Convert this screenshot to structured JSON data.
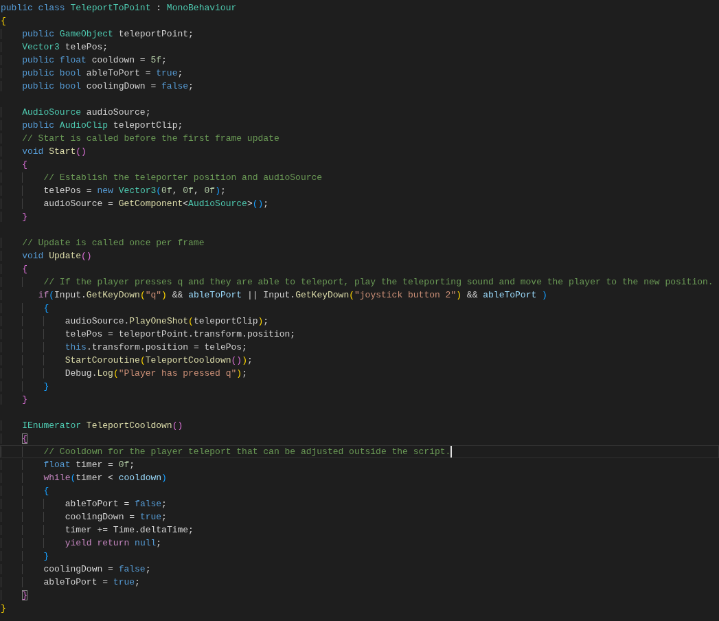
{
  "editor": {
    "lines": [
      {
        "current": false,
        "tokens": [
          {
            "text": "public class ",
            "kind": "keyword"
          },
          {
            "text": "TeleportToPoint",
            "kind": "type"
          },
          {
            "text": " : ",
            "kind": "plain"
          },
          {
            "text": "MonoBehaviour",
            "kind": "type"
          }
        ]
      },
      {
        "current": false,
        "tokens": [
          {
            "text": "{",
            "kind": "bracket0"
          }
        ]
      },
      {
        "current": false,
        "tokens": [
          {
            "text": "    public ",
            "kind": "keyword"
          },
          {
            "text": "GameObject",
            "kind": "type"
          },
          {
            "text": " teleportPoint;",
            "kind": "plain"
          }
        ]
      },
      {
        "current": false,
        "tokens": [
          {
            "text": "    Vector3",
            "kind": "type"
          },
          {
            "text": " telePos;",
            "kind": "plain"
          }
        ]
      },
      {
        "current": false,
        "tokens": [
          {
            "text": "    public float ",
            "kind": "keyword"
          },
          {
            "text": "cooldown = ",
            "kind": "plain"
          },
          {
            "text": "5f",
            "kind": "number"
          },
          {
            "text": ";",
            "kind": "plain"
          }
        ]
      },
      {
        "current": false,
        "tokens": [
          {
            "text": "    public bool ",
            "kind": "keyword"
          },
          {
            "text": "ableToPort = ",
            "kind": "plain"
          },
          {
            "text": "true",
            "kind": "keyword"
          },
          {
            "text": ";",
            "kind": "plain"
          }
        ]
      },
      {
        "current": false,
        "tokens": [
          {
            "text": "    public bool ",
            "kind": "keyword"
          },
          {
            "text": "coolingDown = ",
            "kind": "plain"
          },
          {
            "text": "false",
            "kind": "keyword"
          },
          {
            "text": ";",
            "kind": "plain"
          }
        ]
      },
      {
        "current": false
      },
      {
        "current": false,
        "tokens": [
          {
            "text": "    AudioSource",
            "kind": "type"
          },
          {
            "text": " audioSource;",
            "kind": "plain"
          }
        ]
      },
      {
        "current": false,
        "tokens": [
          {
            "text": "    public ",
            "kind": "keyword"
          },
          {
            "text": "AudioClip",
            "kind": "type"
          },
          {
            "text": " teleportClip;",
            "kind": "plain"
          }
        ]
      },
      {
        "current": false,
        "tokens": [
          {
            "text": "    // Start is called before the first frame update",
            "kind": "comment"
          }
        ]
      },
      {
        "current": false,
        "tokens": [
          {
            "text": "    void ",
            "kind": "keyword"
          },
          {
            "text": "Start",
            "kind": "function"
          },
          {
            "text": "()",
            "kind": "bracket1"
          }
        ]
      },
      {
        "current": false,
        "tokens": [
          {
            "text": "    {",
            "kind": "bracket1"
          }
        ]
      },
      {
        "current": false,
        "tokens": [
          {
            "text": "        // Establish the teleporter position and audioSource",
            "kind": "comment"
          }
        ]
      },
      {
        "current": false,
        "tokens": [
          {
            "text": "        telePos = ",
            "kind": "plain"
          },
          {
            "text": "new ",
            "kind": "keyword"
          },
          {
            "text": "Vector3",
            "kind": "type"
          },
          {
            "text": "(",
            "kind": "bracket2"
          },
          {
            "text": "0f",
            "kind": "number"
          },
          {
            "text": ", ",
            "kind": "plain"
          },
          {
            "text": "0f",
            "kind": "number"
          },
          {
            "text": ", ",
            "kind": "plain"
          },
          {
            "text": "0f",
            "kind": "number"
          },
          {
            "text": ")",
            "kind": "bracket2"
          },
          {
            "text": ";",
            "kind": "plain"
          }
        ]
      },
      {
        "current": false,
        "tokens": [
          {
            "text": "        audioSource = ",
            "kind": "plain"
          },
          {
            "text": "GetComponent",
            "kind": "function"
          },
          {
            "text": "<",
            "kind": "plain"
          },
          {
            "text": "AudioSource",
            "kind": "type"
          },
          {
            "text": ">",
            "kind": "plain"
          },
          {
            "text": "()",
            "kind": "bracket2"
          },
          {
            "text": ";",
            "kind": "plain"
          }
        ]
      },
      {
        "current": false,
        "tokens": [
          {
            "text": "    }",
            "kind": "bracket1"
          }
        ]
      },
      {
        "current": false
      },
      {
        "current": false,
        "tokens": [
          {
            "text": "    // Update is called once per frame",
            "kind": "comment"
          }
        ]
      },
      {
        "current": false,
        "tokens": [
          {
            "text": "    void ",
            "kind": "keyword"
          },
          {
            "text": "Update",
            "kind": "function"
          },
          {
            "text": "()",
            "kind": "bracket1"
          }
        ]
      },
      {
        "current": false,
        "tokens": [
          {
            "text": "    {",
            "kind": "bracket1"
          }
        ]
      },
      {
        "current": false,
        "tokens": [
          {
            "text": "        // If the player presses q and they are able to teleport, play the teleporting sound and move the player to the new position.",
            "kind": "comment"
          }
        ]
      },
      {
        "current": false,
        "tokens": [
          {
            "text": "       if",
            "kind": "control"
          },
          {
            "text": "(",
            "kind": "bracket2"
          },
          {
            "text": "Input.",
            "kind": "plain"
          },
          {
            "text": "GetKeyDown",
            "kind": "function"
          },
          {
            "text": "(",
            "kind": "bracket0"
          },
          {
            "text": "\"q\"",
            "kind": "string"
          },
          {
            "text": ")",
            "kind": "bracket0"
          },
          {
            "text": " && ",
            "kind": "plain"
          },
          {
            "text": "ableToPort",
            "kind": "variable"
          },
          {
            "text": " || ",
            "kind": "plain"
          },
          {
            "text": "Input.",
            "kind": "plain"
          },
          {
            "text": "GetKeyDown",
            "kind": "function"
          },
          {
            "text": "(",
            "kind": "bracket0"
          },
          {
            "text": "\"joystick button 2\"",
            "kind": "string"
          },
          {
            "text": ")",
            "kind": "bracket0"
          },
          {
            "text": " && ",
            "kind": "plain"
          },
          {
            "text": "ableToPort",
            "kind": "variable"
          },
          {
            "text": " )",
            "kind": "bracket2"
          }
        ]
      },
      {
        "current": false,
        "tokens": [
          {
            "text": "        {",
            "kind": "bracket2"
          }
        ]
      },
      {
        "current": false,
        "tokens": [
          {
            "text": "            audioSource.",
            "kind": "plain"
          },
          {
            "text": "PlayOneShot",
            "kind": "function"
          },
          {
            "text": "(",
            "kind": "bracket0"
          },
          {
            "text": "teleportClip",
            "kind": "plain"
          },
          {
            "text": ")",
            "kind": "bracket0"
          },
          {
            "text": ";",
            "kind": "plain"
          }
        ]
      },
      {
        "current": false,
        "tokens": [
          {
            "text": "            telePos = teleportPoint.transform.position;",
            "kind": "plain"
          }
        ]
      },
      {
        "current": false,
        "tokens": [
          {
            "text": "            this",
            "kind": "keyword"
          },
          {
            "text": ".transform.position = telePos;",
            "kind": "plain"
          }
        ]
      },
      {
        "current": false,
        "tokens": [
          {
            "text": "            StartCoroutine",
            "kind": "function"
          },
          {
            "text": "(",
            "kind": "bracket0"
          },
          {
            "text": "TeleportCooldown",
            "kind": "function"
          },
          {
            "text": "()",
            "kind": "bracket1"
          },
          {
            "text": ")",
            "kind": "bracket0"
          },
          {
            "text": ";",
            "kind": "plain"
          }
        ]
      },
      {
        "current": false,
        "tokens": [
          {
            "text": "            Debug.",
            "kind": "plain"
          },
          {
            "text": "Log",
            "kind": "function"
          },
          {
            "text": "(",
            "kind": "bracket0"
          },
          {
            "text": "\"Player has pressed q\"",
            "kind": "string"
          },
          {
            "text": ")",
            "kind": "bracket0"
          },
          {
            "text": ";",
            "kind": "plain"
          }
        ]
      },
      {
        "current": false,
        "tokens": [
          {
            "text": "        }",
            "kind": "bracket2"
          }
        ]
      },
      {
        "current": false,
        "tokens": [
          {
            "text": "    }",
            "kind": "bracket1"
          }
        ]
      },
      {
        "current": false
      },
      {
        "current": false,
        "tokens": [
          {
            "text": "    IEnumerator ",
            "kind": "type"
          },
          {
            "text": "TeleportCooldown",
            "kind": "function"
          },
          {
            "text": "()",
            "kind": "bracket1"
          }
        ]
      },
      {
        "current": false,
        "tokens": [
          {
            "text": "    {",
            "kind": "matched-bracket"
          }
        ]
      },
      {
        "current": true,
        "tokens": [
          {
            "text": "        // Cooldown for the player teleport that can be adjusted outside the script.",
            "kind": "comment"
          }
        ]
      },
      {
        "current": false,
        "tokens": [
          {
            "text": "        float ",
            "kind": "keyword"
          },
          {
            "text": "timer = ",
            "kind": "plain"
          },
          {
            "text": "0f",
            "kind": "number"
          },
          {
            "text": ";",
            "kind": "plain"
          }
        ]
      },
      {
        "current": false,
        "tokens": [
          {
            "text": "        while",
            "kind": "control"
          },
          {
            "text": "(",
            "kind": "bracket2"
          },
          {
            "text": "timer < ",
            "kind": "plain"
          },
          {
            "text": "cooldown",
            "kind": "variable"
          },
          {
            "text": ")",
            "kind": "bracket2"
          }
        ]
      },
      {
        "current": false,
        "tokens": [
          {
            "text": "        {",
            "kind": "bracket2"
          }
        ]
      },
      {
        "current": false,
        "tokens": [
          {
            "text": "            ableToPort = ",
            "kind": "plain"
          },
          {
            "text": "false",
            "kind": "keyword"
          },
          {
            "text": ";",
            "kind": "plain"
          }
        ]
      },
      {
        "current": false,
        "tokens": [
          {
            "text": "            coolingDown = ",
            "kind": "plain"
          },
          {
            "text": "true",
            "kind": "keyword"
          },
          {
            "text": ";",
            "kind": "plain"
          }
        ]
      },
      {
        "current": false,
        "tokens": [
          {
            "text": "            timer += Time.deltaTime;",
            "kind": "plain"
          }
        ]
      },
      {
        "current": false,
        "tokens": [
          {
            "text": "            yield return ",
            "kind": "control"
          },
          {
            "text": "null",
            "kind": "keyword"
          },
          {
            "text": ";",
            "kind": "plain"
          }
        ]
      },
      {
        "current": false,
        "tokens": [
          {
            "text": "        }",
            "kind": "bracket2"
          }
        ]
      },
      {
        "current": false,
        "tokens": [
          {
            "text": "        coolingDown = ",
            "kind": "plain"
          },
          {
            "text": "false",
            "kind": "keyword"
          },
          {
            "text": ";",
            "kind": "plain"
          }
        ]
      },
      {
        "current": false,
        "tokens": [
          {
            "text": "        ableToPort = ",
            "kind": "plain"
          },
          {
            "text": "true",
            "kind": "keyword"
          },
          {
            "text": ";",
            "kind": "plain"
          }
        ]
      },
      {
        "current": false,
        "tokens": [
          {
            "text": "    }",
            "kind": "matched-bracket"
          }
        ]
      },
      {
        "current": false,
        "tokens": [
          {
            "text": "}",
            "kind": "bracket0"
          }
        ]
      }
    ]
  }
}
